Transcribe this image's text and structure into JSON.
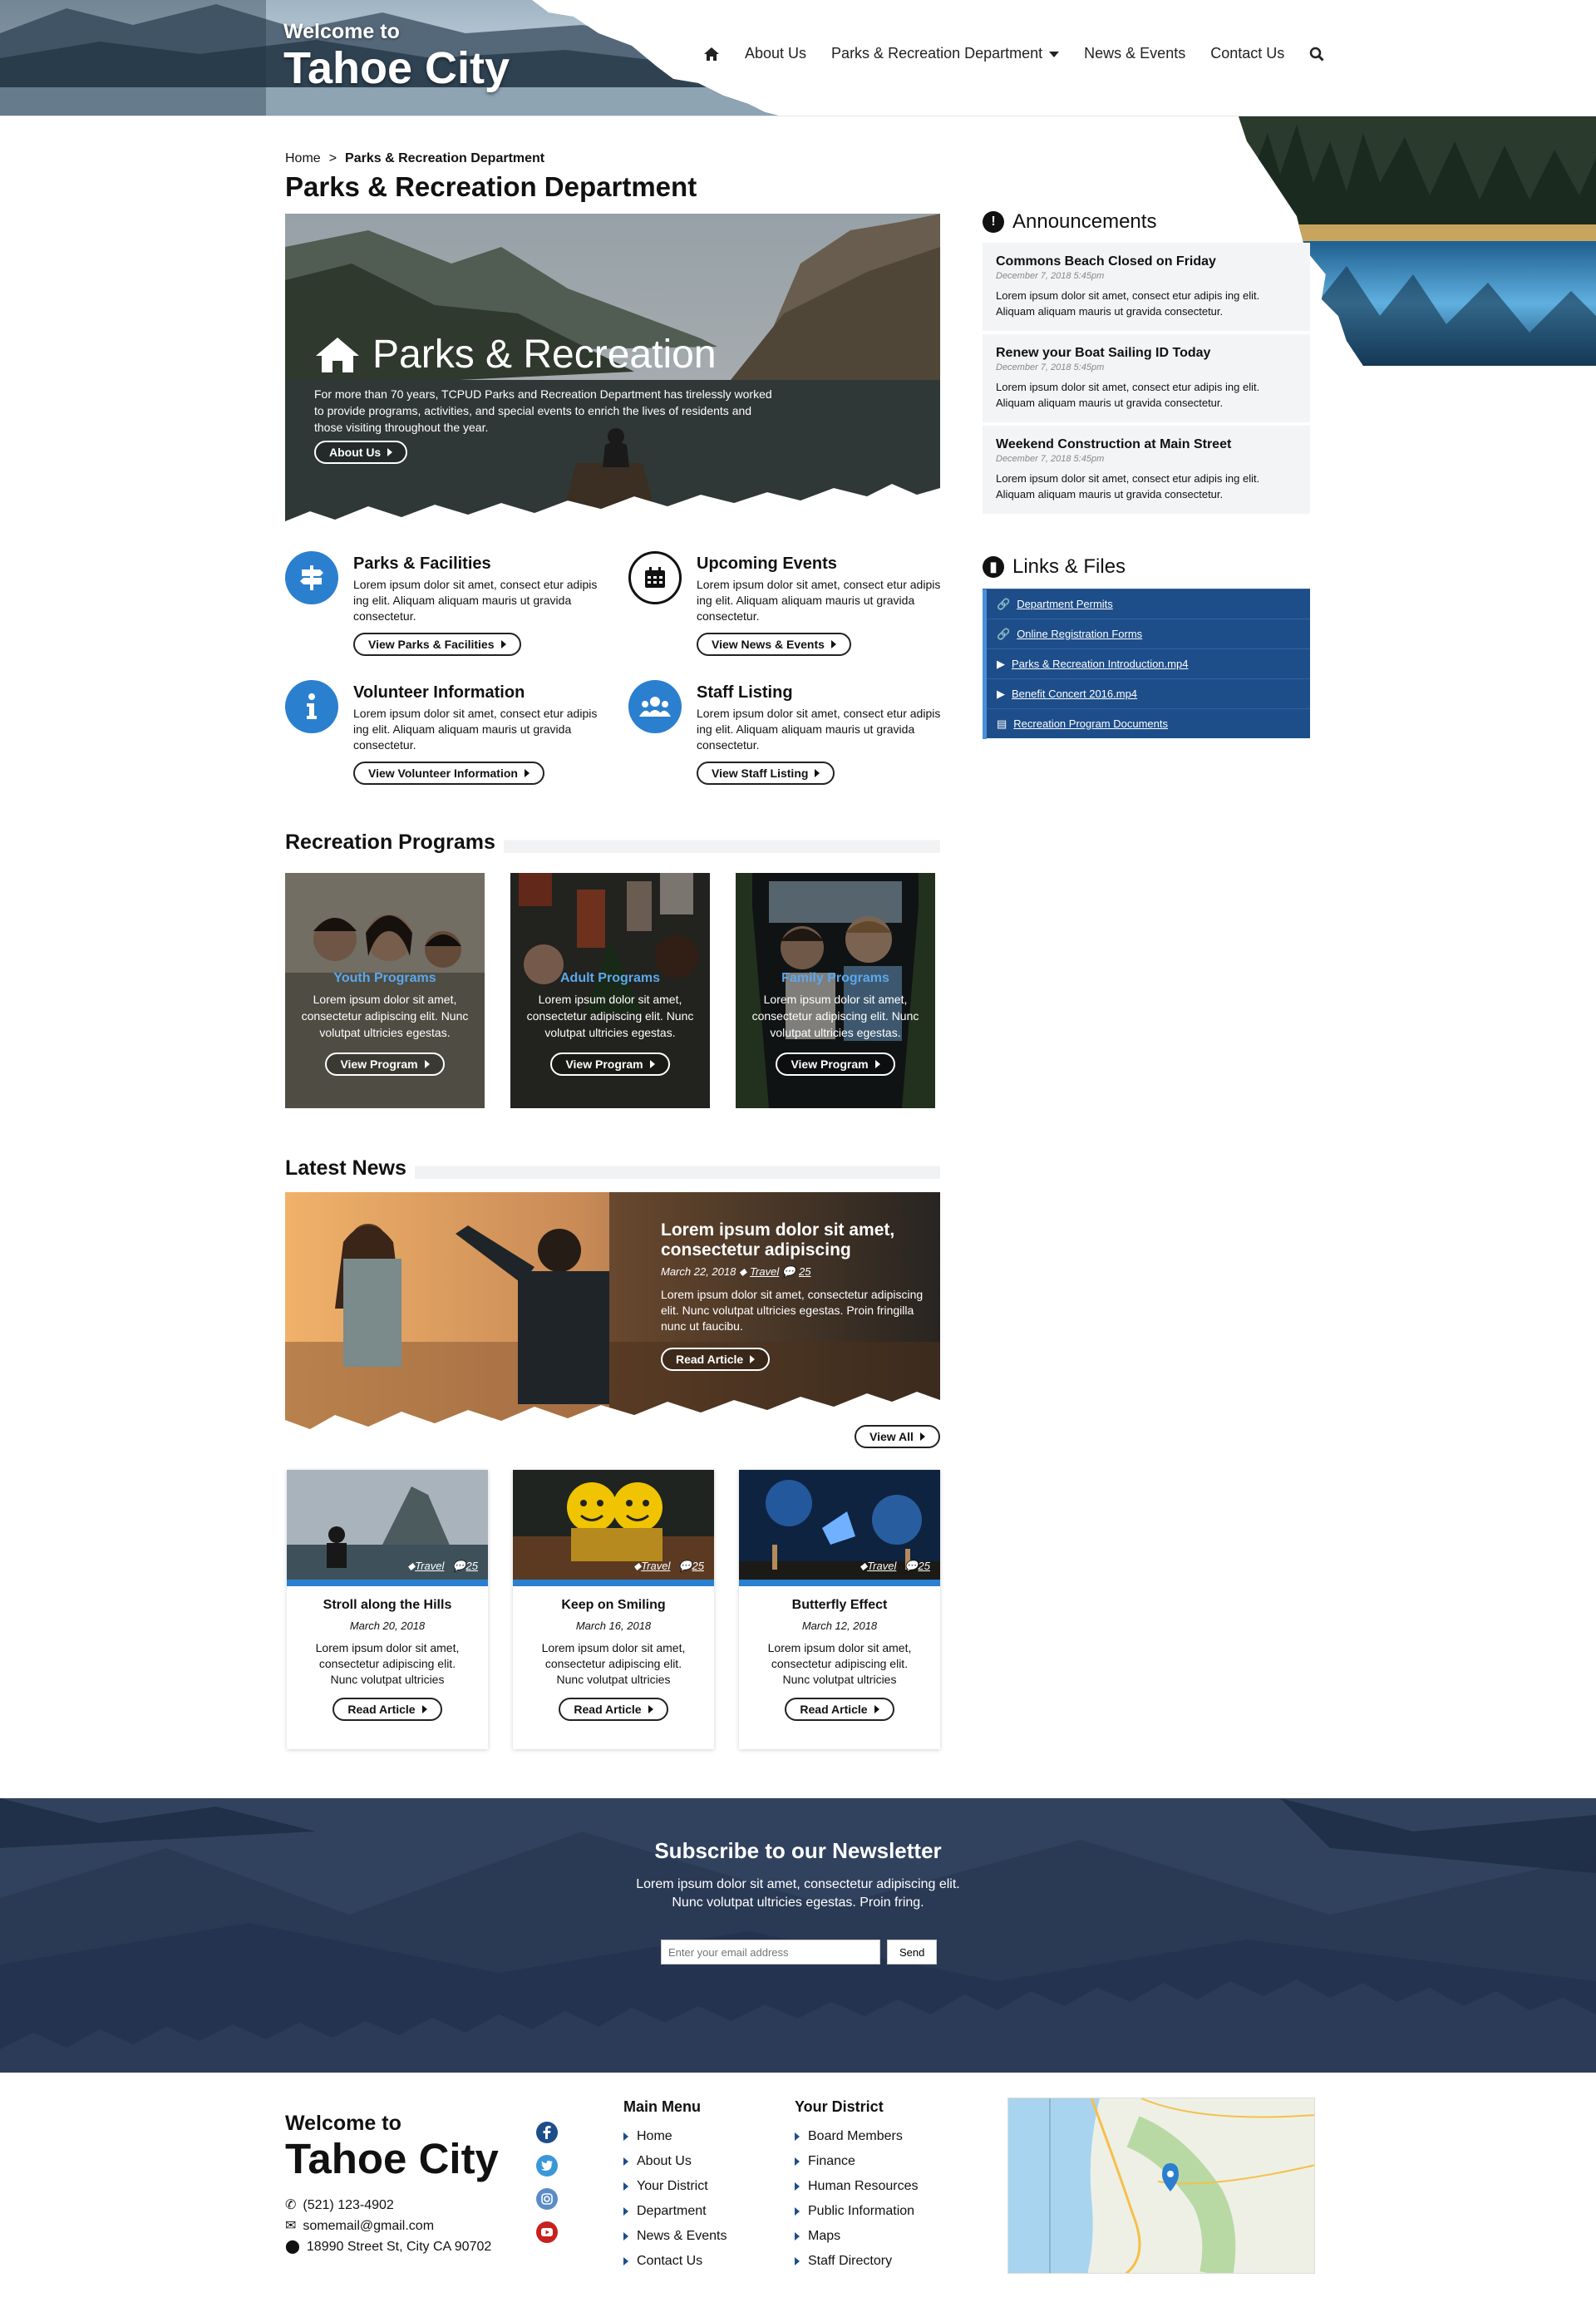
{
  "header": {
    "welcome": "Welcome to",
    "city": "Tahoe City",
    "nav": {
      "about": "About Us",
      "parks": "Parks & Recreation Department",
      "news": "News & Events",
      "contact": "Contact Us"
    }
  },
  "breadcrumb": {
    "home": "Home",
    "separator": ">",
    "current": "Parks & Recreation Department"
  },
  "page_title": "Parks & Recreation Department",
  "hero": {
    "title": "Parks & Recreation",
    "text": "For more than 70 years, TCPUD Parks and Recreation Department has tirelessly worked to provide programs, activities, and special events to enrich the lives of residents and those visiting throughout the year.",
    "button": "About Us"
  },
  "features": [
    {
      "title": "Parks & Facilities",
      "text": "Lorem ipsum dolor sit amet, consect etur adipis ing elit. Aliquam aliquam mauris ut gravida consectetur.",
      "button": "View Parks & Facilities",
      "icon": "signpost-icon"
    },
    {
      "title": "Upcoming Events",
      "text": "Lorem ipsum dolor sit amet, consect etur adipis ing elit. Aliquam aliquam mauris ut gravida consectetur.",
      "button": "View News & Events",
      "icon": "calendar-icon"
    },
    {
      "title": "Volunteer Information",
      "text": "Lorem ipsum dolor sit amet, consect etur adipis ing elit. Aliquam aliquam mauris ut gravida consectetur.",
      "button": "View Volunteer Information",
      "icon": "info-icon"
    },
    {
      "title": "Staff Listing",
      "text": "Lorem ipsum dolor sit amet, consect etur adipis ing elit. Aliquam aliquam mauris ut gravida consectetur.",
      "button": "View Staff Listing",
      "icon": "users-icon"
    }
  ],
  "programs": {
    "heading": "Recreation Programs",
    "items": [
      {
        "title": "Youth Programs",
        "text": "Lorem ipsum dolor sit amet, consectetur adipiscing elit. Nunc volutpat ultricies egestas.",
        "button": "View Program"
      },
      {
        "title": "Adult Programs",
        "text": "Lorem ipsum dolor sit amet, consectetur adipiscing elit. Nunc volutpat ultricies egestas.",
        "button": "View Program"
      },
      {
        "title": "Family Programs",
        "text": "Lorem ipsum dolor sit amet, consectetur adipiscing elit. Nunc volutpat ultricies egestas.",
        "button": "View Program"
      }
    ]
  },
  "news": {
    "heading": "Latest News",
    "featured": {
      "title": "Lorem ipsum dolor sit amet, consectetur adipiscing",
      "date": "March 22, 2018",
      "tag": "Travel",
      "comments": "25",
      "text": "Lorem ipsum dolor sit amet, consectetur adipiscing elit. Nunc volutpat ultricies egestas. Proin fringilla nunc ut faucibu.",
      "button": "Read Article"
    },
    "view_all": "View All",
    "cards": [
      {
        "title": "Stroll along the Hills",
        "date": "March 20, 2018",
        "tag": "Travel",
        "comments": "25",
        "text": "Lorem ipsum dolor sit amet, consectetur adipiscing elit. Nunc volutpat ultricies",
        "button": "Read Article"
      },
      {
        "title": "Keep on Smiling",
        "date": "March 16, 2018",
        "tag": "Travel",
        "comments": "25",
        "text": "Lorem ipsum dolor sit amet, consectetur adipiscing elit. Nunc volutpat ultricies",
        "button": "Read Article"
      },
      {
        "title": "Butterfly Effect",
        "date": "March 12, 2018",
        "tag": "Travel",
        "comments": "25",
        "text": "Lorem ipsum dolor sit amet, consectetur adipiscing elit. Nunc volutpat ultricies",
        "button": "Read Article"
      }
    ]
  },
  "announcements": {
    "heading": "Announcements",
    "items": [
      {
        "title": "Commons Beach Closed on Friday",
        "date": "December 7, 2018 5:45pm",
        "text": "Lorem ipsum dolor sit amet, consect etur adipis ing elit. Aliquam aliquam mauris ut gravida consectetur."
      },
      {
        "title": "Renew your Boat Sailing ID Today",
        "date": "December 7, 2018 5:45pm",
        "text": "Lorem ipsum dolor sit amet, consect etur adipis ing elit. Aliquam aliquam mauris ut gravida consectetur."
      },
      {
        "title": "Weekend Construction at Main Street",
        "date": "December 7, 2018 5:45pm",
        "text": "Lorem ipsum dolor sit amet, consect etur adipis ing elit. Aliquam aliquam mauris ut gravida consectetur."
      }
    ]
  },
  "links": {
    "heading": "Links & Files",
    "items": [
      {
        "label": "Department Permits",
        "icon": "link-icon"
      },
      {
        "label": "Online Registration Forms",
        "icon": "link-icon"
      },
      {
        "label": "Parks & Recreation Introduction.mp4",
        "icon": "play-icon"
      },
      {
        "label": "Benefit Concert 2016.mp4",
        "icon": "play-icon"
      },
      {
        "label": "Recreation Program Documents",
        "icon": "file-icon"
      }
    ]
  },
  "newsletter": {
    "title": "Subscribe to our Newsletter",
    "text1": "Lorem ipsum dolor sit amet, consectetur adipiscing elit.",
    "text2": "Nunc volutpat ultricies egestas. Proin fring.",
    "placeholder": "Enter your email address",
    "button": "Send"
  },
  "footer": {
    "welcome": "Welcome to",
    "city": "Tahoe City",
    "phone": "(521) 123-4902",
    "email": "somemail@gmail.com",
    "address": "18990 Street St, City CA 90702",
    "social": [
      "facebook-icon",
      "twitter-icon",
      "instagram-icon",
      "youtube-icon"
    ],
    "main_menu": {
      "heading": "Main Menu",
      "items": [
        "Home",
        "About Us",
        "Your District",
        "Department",
        "News & Events",
        "Contact Us"
      ]
    },
    "district": {
      "heading": "Your District",
      "items": [
        "Board Members",
        "Finance",
        "Human Resources",
        "Public Information",
        "Maps",
        "Staff Directory"
      ]
    }
  },
  "colors": {
    "accent": "#2b7fcf",
    "navy": "#1d4e89",
    "newsletter_bg": "#2c3c58"
  }
}
